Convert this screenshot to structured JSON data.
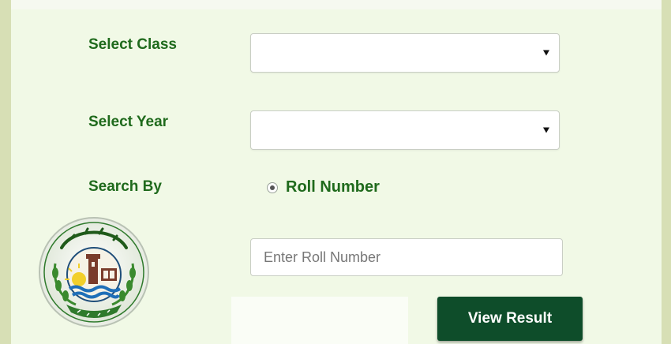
{
  "form": {
    "class_label": "Select Class",
    "class_value": "",
    "year_label": "Select Year",
    "year_value": "",
    "search_by_label": "Search By",
    "search_option": "Roll Number",
    "roll_placeholder": "Enter Roll Number",
    "roll_value": "",
    "submit_label": "View Result"
  },
  "icons": {
    "dropdown": "chevron-down-icon",
    "logo": "board-emblem-icon"
  },
  "colors": {
    "label_green": "#1f6a1c",
    "button_green": "#0e4d2a",
    "panel_bg": "#f1f9e6"
  }
}
